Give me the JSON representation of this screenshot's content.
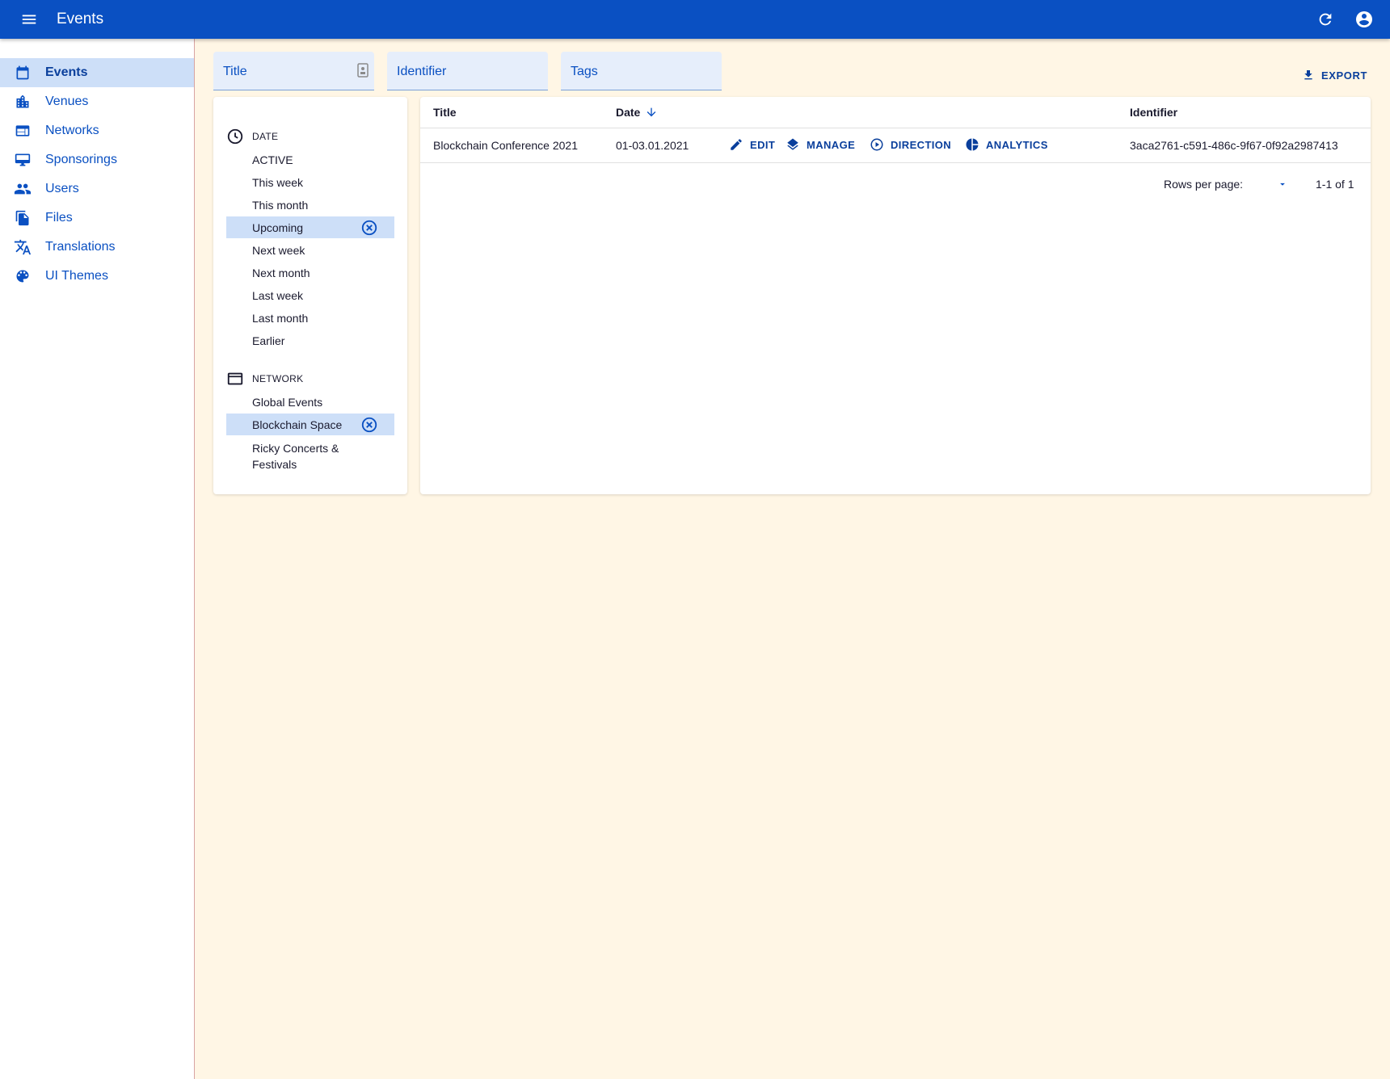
{
  "appbar": {
    "title": "Events"
  },
  "sidebar": {
    "items": [
      {
        "label": "Events",
        "icon": "calendar-icon",
        "active": true
      },
      {
        "label": "Venues",
        "icon": "building-icon"
      },
      {
        "label": "Networks",
        "icon": "web-window-icon"
      },
      {
        "label": "Sponsorings",
        "icon": "billboard-icon"
      },
      {
        "label": "Users",
        "icon": "people-icon"
      },
      {
        "label": "Files",
        "icon": "files-icon"
      },
      {
        "label": "Translations",
        "icon": "translate-icon"
      },
      {
        "label": "UI Themes",
        "icon": "palette-icon"
      }
    ]
  },
  "filters": {
    "title_placeholder": "Title",
    "identifier_placeholder": "Identifier",
    "tags_placeholder": "Tags"
  },
  "export_label": "EXPORT",
  "filter_panel": {
    "date_heading": "DATE",
    "date_options": [
      "ACTIVE",
      "This week",
      "This month",
      "Upcoming",
      "Next week",
      "Next month",
      "Last week",
      "Last month",
      "Earlier"
    ],
    "date_selected": "Upcoming",
    "network_heading": "NETWORK",
    "network_options": [
      "Global Events",
      "Blockchain Space",
      "Ricky Concerts & Festivals"
    ],
    "network_selected": "Blockchain Space"
  },
  "table": {
    "columns": {
      "title": "Title",
      "date": "Date",
      "identifier": "Identifier"
    },
    "rows": [
      {
        "title": "Blockchain Conference 2021",
        "date": "01-03.01.2021",
        "identifier": "3aca2761-c591-486c-9f67-0f92a2987413"
      }
    ],
    "actions": {
      "edit": "EDIT",
      "manage": "MANAGE",
      "direction": "DIRECTION",
      "analytics": "ANALYTICS"
    },
    "rows_per_page_label": "Rows per page:",
    "pagination_text": "1-1 of 1"
  },
  "colors": {
    "primary": "#0a50c2",
    "background": "#fff6e5",
    "selected": "#cddff8"
  }
}
